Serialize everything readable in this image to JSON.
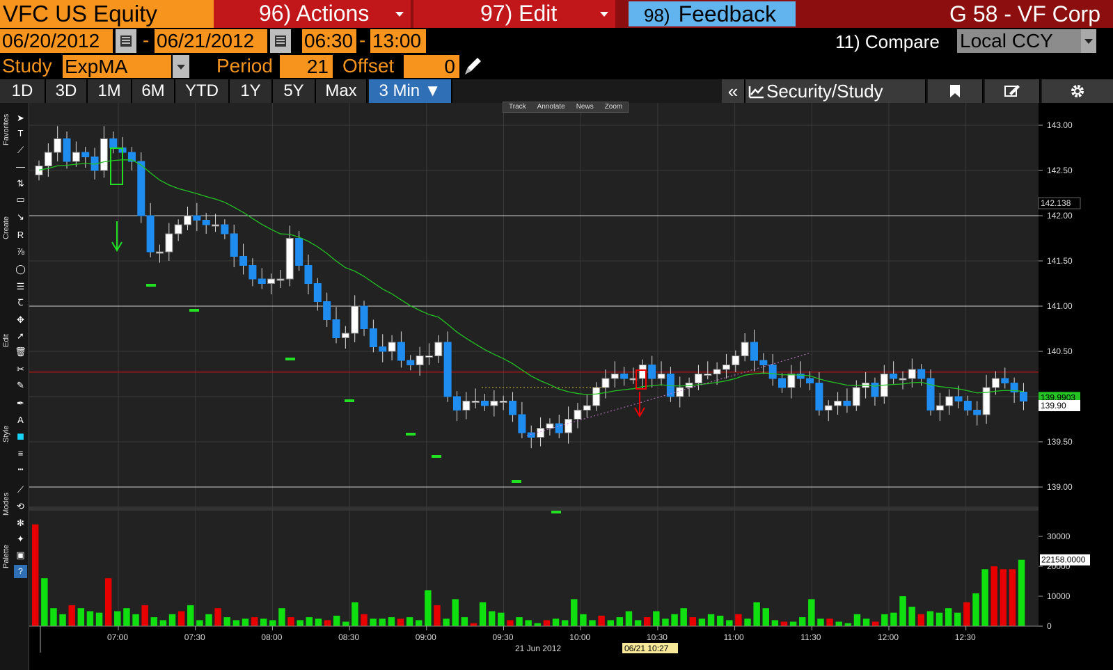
{
  "header": {
    "ticker": "VFC US Equity",
    "actions_label": "96) Actions",
    "edit_label": "97) Edit",
    "feedback_num": "98)",
    "feedback_label": "Feedback",
    "title": "G 58 - VF Corp"
  },
  "range": {
    "start_date": "06/20/2012",
    "end_date": "06/21/2012",
    "start_time": "06:30",
    "end_time": "13:00",
    "separator": "-",
    "compare_label": "11) Compare",
    "currency": "Local CCY"
  },
  "study": {
    "label": "Study",
    "value": "ExpMA",
    "period_label": "Period",
    "period_value": "21",
    "offset_label": "Offset",
    "offset_value": "0"
  },
  "tabs": [
    "1D",
    "3D",
    "1M",
    "6M",
    "YTD",
    "1Y",
    "5Y",
    "Max",
    "3 Min ▼"
  ],
  "right_toolbar": {
    "collapse": "«",
    "security_study": "Security/Study"
  },
  "chart_tools": [
    "Track",
    "Annotate",
    "News",
    "Zoom"
  ],
  "sidebar_sections": [
    "Favorites",
    "Create",
    "Edit",
    "Style",
    "Modes",
    "Palette"
  ],
  "price_axis": [
    "143.00",
    "142.50",
    "142.00",
    "141.50",
    "141.00",
    "140.50",
    "140.00",
    "139.50",
    "139.00"
  ],
  "price_flags": {
    "ema": "142.138",
    "last_a": "139.9903",
    "last_b": "139.90"
  },
  "volume_axis": [
    "30000",
    "20000",
    "10000",
    "0"
  ],
  "volume_flag": "22158.0000",
  "time_axis": [
    "07:00",
    "07:30",
    "08:00",
    "08:30",
    "09:00",
    "09:30",
    "10:00",
    "10:30",
    "11:00",
    "11:30",
    "12:00",
    "12:30"
  ],
  "date_label": "21 Jun 2012",
  "cursor_label": "06/21 10:27",
  "colors": {
    "up": "#ffffff",
    "down": "#1f8cf0",
    "ema": "#22c322",
    "vol_up": "#10e010",
    "vol_down": "#e80000",
    "accent": "#f7941d"
  },
  "chart_data": {
    "type": "candlestick",
    "interval": "3 Min",
    "x_range": [
      "06:30",
      "13:00"
    ],
    "ylim": [
      138.8,
      143.2
    ],
    "study": "ExpMA 21",
    "series_close": [
      142.55,
      142.7,
      142.85,
      142.6,
      142.7,
      142.65,
      142.5,
      142.85,
      142.75,
      142.7,
      142.6,
      142.0,
      141.6,
      141.6,
      141.8,
      141.9,
      142.0,
      141.95,
      141.9,
      141.9,
      141.8,
      141.55,
      141.45,
      141.3,
      141.25,
      141.3,
      141.3,
      141.75,
      141.45,
      141.25,
      141.05,
      140.85,
      140.65,
      140.7,
      141.0,
      140.75,
      140.55,
      140.5,
      140.6,
      140.4,
      140.35,
      140.45,
      140.45,
      140.6,
      140.0,
      139.85,
      139.95,
      139.95,
      139.9,
      139.95,
      139.95,
      139.8,
      139.6,
      139.55,
      139.65,
      139.7,
      139.6,
      139.75,
      139.85,
      139.9,
      140.1,
      140.2,
      140.25,
      140.2,
      140.2,
      140.35,
      140.2,
      140.25,
      140.0,
      140.1,
      140.15,
      140.25,
      140.25,
      140.3,
      140.35,
      140.45,
      140.6,
      140.4,
      140.35,
      140.2,
      140.1,
      140.25,
      140.2,
      140.15,
      139.85,
      139.9,
      139.95,
      139.9,
      140.1,
      140.15,
      140.0,
      140.25,
      140.2,
      140.2,
      140.3,
      140.2,
      139.85,
      139.9,
      140.0,
      139.95,
      139.85,
      139.8,
      140.1,
      140.2,
      140.15,
      140.05,
      139.95
    ]
  }
}
